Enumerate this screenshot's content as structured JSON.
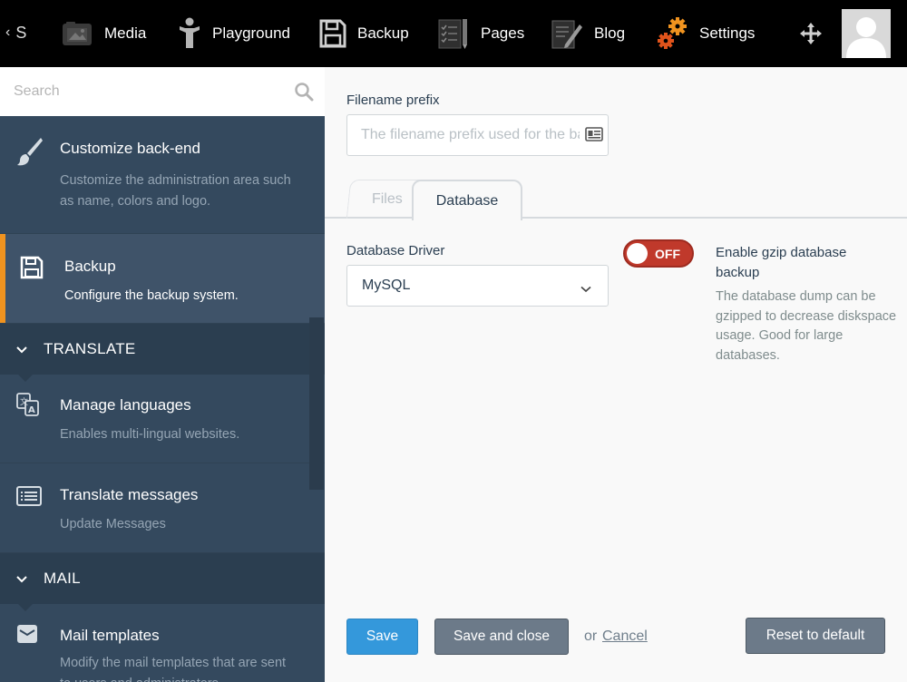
{
  "topbar": {
    "back_label": "S",
    "items": [
      {
        "label": "Media",
        "icon": "media-icon"
      },
      {
        "label": "Playground",
        "icon": "playground-icon"
      },
      {
        "label": "Backup",
        "icon": "floppy-icon"
      },
      {
        "label": "Pages",
        "icon": "pages-icon"
      },
      {
        "label": "Blog",
        "icon": "blog-icon"
      },
      {
        "label": "Settings",
        "icon": "gears-icon"
      }
    ]
  },
  "sidebar": {
    "search_placeholder": "Search",
    "items": [
      {
        "title": "Customize back-end",
        "description": "Customize the administration area such as name, colors and logo.",
        "icon": "brush-icon"
      },
      {
        "title": "Backup",
        "description": "Configure the backup system.",
        "icon": "floppy-icon",
        "active": true
      },
      {
        "title": "Manage languages",
        "description": "Enables multi-lingual websites.",
        "icon": "language-icon"
      },
      {
        "title": "Translate messages",
        "description": "Update Messages",
        "icon": "list-icon"
      },
      {
        "title": "Mail templates",
        "description": "Modify the mail templates that are sent to users and administrators",
        "icon": "envelope-icon"
      }
    ],
    "sections": [
      {
        "label": "TRANSLATE"
      },
      {
        "label": "MAIL"
      }
    ]
  },
  "form": {
    "prefix_label": "Filename prefix",
    "prefix_placeholder": "The filename prefix used for the backups",
    "tabs": [
      {
        "label": "Files",
        "active": false
      },
      {
        "label": "Database",
        "active": true
      }
    ],
    "driver_label": "Database Driver",
    "driver_value": "MySQL",
    "gzip_toggle_state": "OFF",
    "gzip_title": "Enable gzip database backup",
    "gzip_description": "The database dump can be gzipped to decrease diskspace usage. Good for large databases."
  },
  "actions": {
    "save": "Save",
    "save_close": "Save and close",
    "or": "or",
    "cancel": "Cancel",
    "reset": "Reset to default"
  },
  "colors": {
    "topbar_bg": "#000000",
    "sidebar_bg": "#34495e",
    "active_accent": "#f0931f",
    "save_button": "#3498db",
    "toggle_off": "#c0392b"
  }
}
